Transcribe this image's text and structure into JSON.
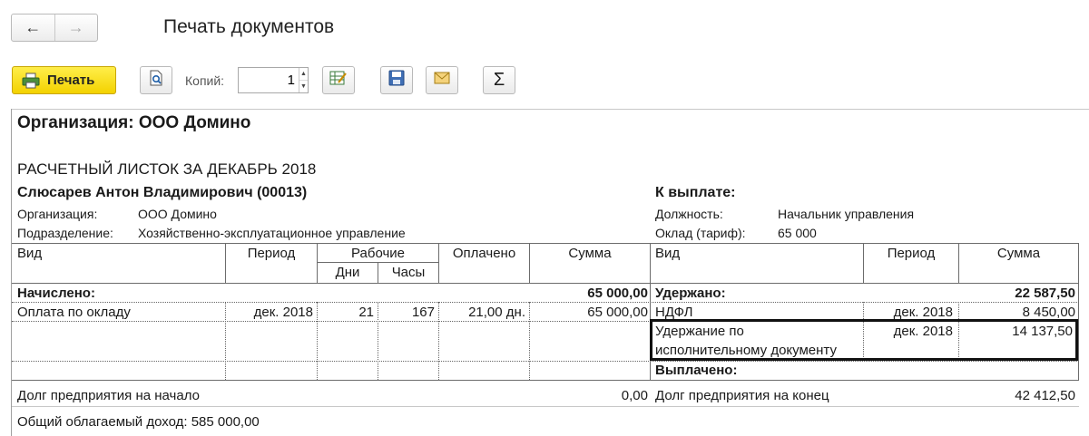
{
  "window": {
    "title": "Печать документов"
  },
  "toolbar": {
    "print_label": "Печать",
    "copies_label": "Копий:",
    "copies_value": "1"
  },
  "document": {
    "organization_heading": "Организация: ООО Домино",
    "sheet_title": "РАСЧЕТНЫЙ ЛИСТОК ЗА ДЕКАБРЬ 2018",
    "employee": "Слюсарев Антон Владимирович (00013)",
    "org_label": "Организация:",
    "org_value": "ООО Домино",
    "dept_label": "Подразделение:",
    "dept_value": "Хозяйственно-эксплуатационное управление",
    "to_pay_label": "К выплате:",
    "position_label": "Должность:",
    "position_value": "Начальник управления",
    "salary_label": "Оклад (тариф):",
    "salary_value": "65 000",
    "headers": {
      "vid": "Вид",
      "period": "Период",
      "working": "Рабочие",
      "days": "Дни",
      "hours": "Часы",
      "paid": "Оплачено",
      "sum": "Сумма",
      "vid_r": "Вид",
      "period_r": "Период",
      "sum_r": "Сумма"
    },
    "accrued_label": "Начислено:",
    "accrued_total": "65 000,00",
    "withheld_label": "Удержано:",
    "withheld_total": "22 587,50",
    "row1": {
      "vid": "Оплата по окладу",
      "period": "дек. 2018",
      "days": "21",
      "hours": "167",
      "paid": "21,00 дн.",
      "sum": "65 000,00"
    },
    "ndfl": {
      "vid": "НДФЛ",
      "period": "дек. 2018",
      "sum": "8 450,00"
    },
    "enforcement": {
      "vid_line1": "Удержание по",
      "vid_line2": "исполнительному документу",
      "period": "дек. 2018",
      "sum": "14 137,50"
    },
    "paid_out_label": "Выплачено:",
    "debt_start_label": "Долг предприятия на начало",
    "debt_start_value": "0,00",
    "debt_end_label": "Долг предприятия на конец",
    "debt_end_value": "42 412,50",
    "taxable_income": "Общий облагаемый доход: 585 000,00"
  }
}
